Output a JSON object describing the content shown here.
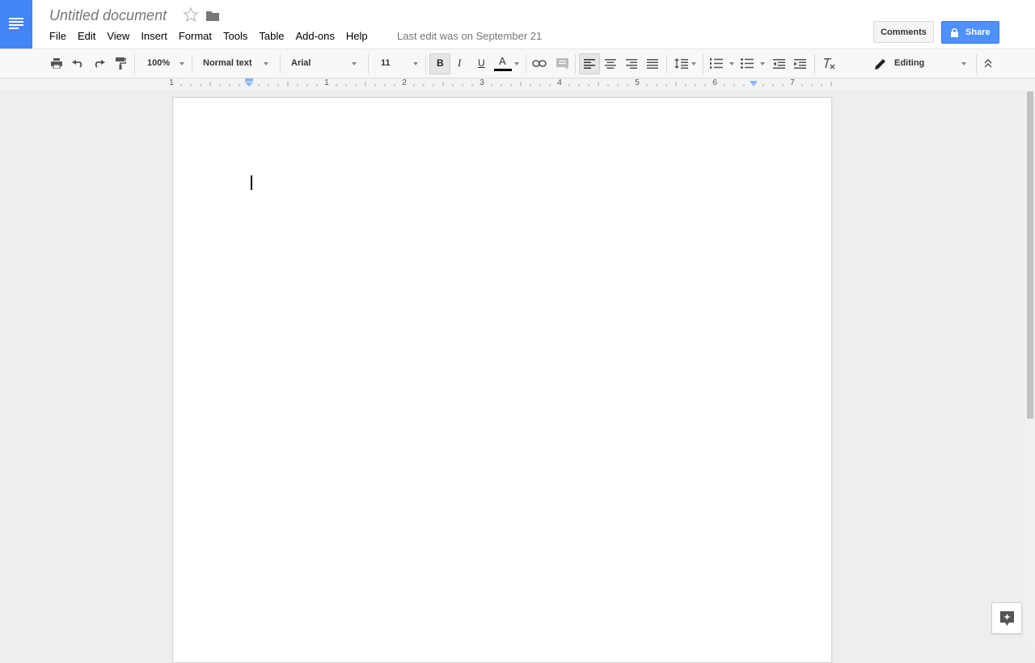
{
  "header": {
    "doc_title": "Untitled document",
    "menu": [
      "File",
      "Edit",
      "View",
      "Insert",
      "Format",
      "Tools",
      "Table",
      "Add-ons",
      "Help"
    ],
    "last_edit": "Last edit was on September 21",
    "comments_label": "Comments",
    "share_label": "Share"
  },
  "toolbar": {
    "zoom": "100%",
    "style": "Normal text",
    "font": "Arial",
    "font_size": "11",
    "bold": "B",
    "italic": "I",
    "underline": "U",
    "text_color_letter": "A",
    "mode": "Editing"
  },
  "ruler": {
    "labels": [
      "1",
      "1",
      "2",
      "3",
      "4",
      "5",
      "6",
      "7"
    ]
  },
  "colors": {
    "brand": "#4285f4",
    "share": "#4d90fe"
  }
}
